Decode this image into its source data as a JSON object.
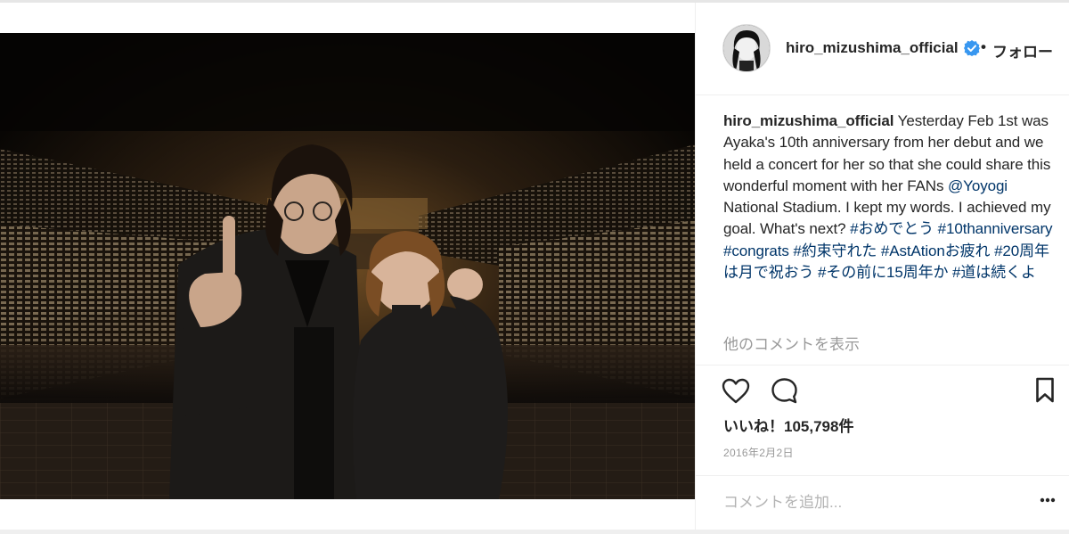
{
  "post": {
    "username": "hiro_mizushima_official",
    "separator": "•",
    "follow_label": "フォロー",
    "caption_user": "hiro_mizushima_official",
    "caption_text_1": " Yesterday Feb 1st was Ayaka's 10th anniversary from her debut and we held a concert for her so that she could share this wonderful moment with her FANs ",
    "caption_mention": "@Yoyogi",
    "caption_text_2": " National Stadium. I kept my words. I achieved my goal. What's next? ",
    "hashtags": [
      "#おめでとう",
      "#10thanniversary",
      "#congrats",
      "#約束守れた",
      "#AstAtionお疲れ",
      "#20周年は月で祝おう",
      "#その前に15周年か",
      "#道は続くよ"
    ],
    "view_more_comments": "他のコメントを表示",
    "likes_text": "いいね！105,798件",
    "date": "2016年2月2日",
    "comment_placeholder": "コメントを追加..."
  },
  "icons": {
    "verified": "verified-badge-icon",
    "like": "heart-icon",
    "comment": "speech-bubble-icon",
    "save": "bookmark-icon",
    "more": "ellipsis-icon"
  },
  "colors": {
    "link": "#003569",
    "muted": "#999999",
    "verified": "#3897f0",
    "text": "#262626"
  }
}
